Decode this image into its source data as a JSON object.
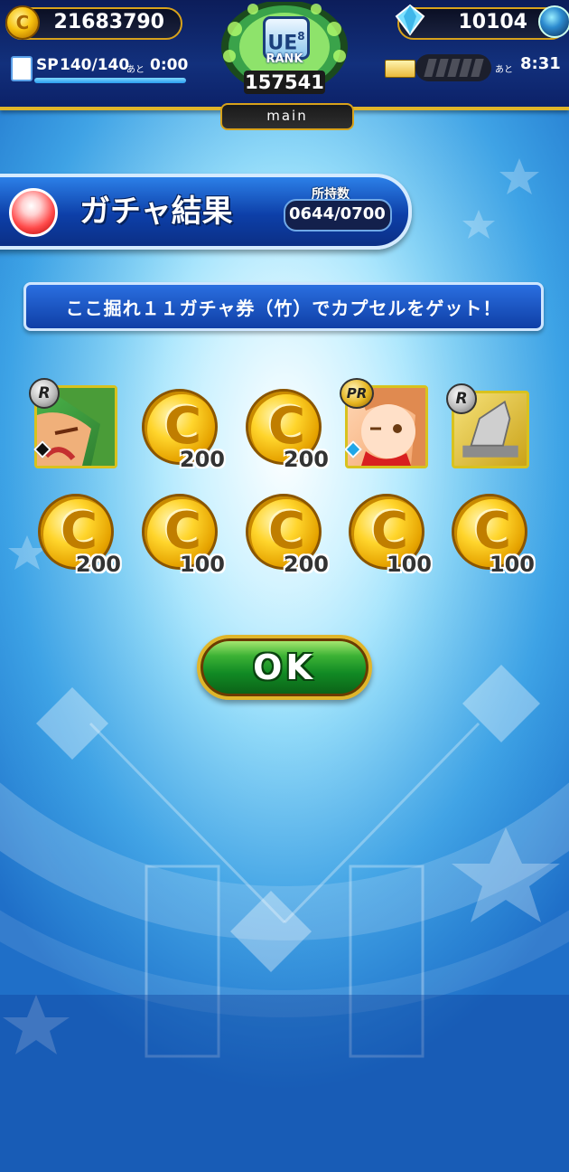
{
  "header": {
    "coins": "21683790",
    "gems": "10104",
    "sp_label": "SP",
    "sp_value": "140/140",
    "sp_after": "あと",
    "sp_time": "0:00",
    "sp_fill": 1.0,
    "rank_label": "RANK",
    "rank_number": "157541",
    "rank_tag": "main",
    "rank_letter": "UE",
    "rank_sub": "8",
    "stamina_after": "あと",
    "stamina_time": "8:31"
  },
  "title": {
    "text": "ガチャ結果",
    "owned_label": "所持数",
    "owned_value": "0644/0700"
  },
  "message": "ここ掘れ１１ガチャ券（竹）でカプセルをゲット！",
  "items_row1": [
    {
      "type": "card",
      "rarity": "R",
      "color": "#3d9b3a"
    },
    {
      "type": "coin",
      "amount": "200"
    },
    {
      "type": "coin",
      "amount": "200"
    },
    {
      "type": "card",
      "rarity": "PR",
      "color": "#f3a36a"
    },
    {
      "type": "card",
      "rarity": "R",
      "color": "#caa218"
    }
  ],
  "items_row2": [
    {
      "type": "coin",
      "amount": "200"
    },
    {
      "type": "coin",
      "amount": "100"
    },
    {
      "type": "coin",
      "amount": "200"
    },
    {
      "type": "coin",
      "amount": "100"
    },
    {
      "type": "coin",
      "amount": "100"
    }
  ],
  "ok_button": "OK"
}
